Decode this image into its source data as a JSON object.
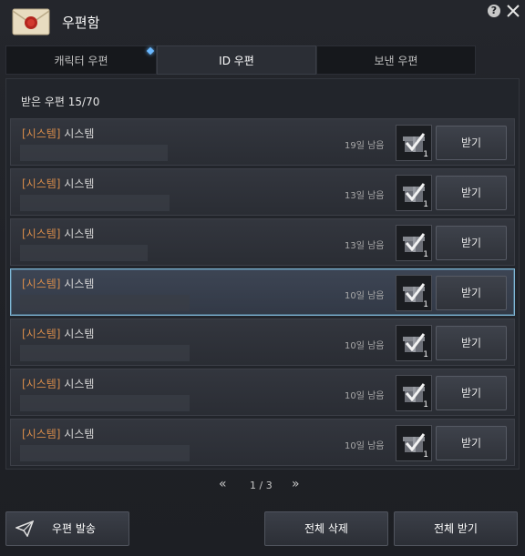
{
  "window": {
    "title": "우편함"
  },
  "icons": {
    "envelope": "envelope-seal-icon",
    "help": "?",
    "close": "close-icon"
  },
  "tabs": [
    {
      "label": "캐릭터 우편",
      "active": false,
      "has_notice": true
    },
    {
      "label": "ID 우편",
      "active": true,
      "has_notice": false
    },
    {
      "label": "보낸 우편",
      "active": false,
      "has_notice": false
    }
  ],
  "inbox": {
    "count_label": "받은 우편 15/70",
    "rows": [
      {
        "tag": "[시스템]",
        "sender": " 시스템",
        "days_left": "19일 남음",
        "item_count": "1",
        "button": "받기",
        "selected": false
      },
      {
        "tag": "[시스템]",
        "sender": " 시스템",
        "days_left": "13일 남음",
        "item_count": "1",
        "button": "받기",
        "selected": false
      },
      {
        "tag": "[시스템]",
        "sender": " 시스템",
        "days_left": "13일 남음",
        "item_count": "1",
        "button": "받기",
        "selected": false
      },
      {
        "tag": "[시스템]",
        "sender": " 시스템",
        "days_left": "10일 남음",
        "item_count": "1",
        "button": "받기",
        "selected": true
      },
      {
        "tag": "[시스템]",
        "sender": " 시스템",
        "days_left": "10일 남음",
        "item_count": "1",
        "button": "받기",
        "selected": false
      },
      {
        "tag": "[시스템]",
        "sender": " 시스템",
        "days_left": "10일 남음",
        "item_count": "1",
        "button": "받기",
        "selected": false
      },
      {
        "tag": "[시스템]",
        "sender": " 시스템",
        "days_left": "10일 남음",
        "item_count": "1",
        "button": "받기",
        "selected": false
      }
    ]
  },
  "pagination": {
    "prev": "«",
    "text": "1 / 3",
    "next": "»"
  },
  "footer": {
    "send_label": "우편 발송",
    "delete_all_label": "전체 삭제",
    "receive_all_label": "전체 받기"
  },
  "colors": {
    "system_tag": "#d88c4a",
    "selected_border": "#7fb7d6",
    "tab_notice": "#6ab8ff"
  }
}
